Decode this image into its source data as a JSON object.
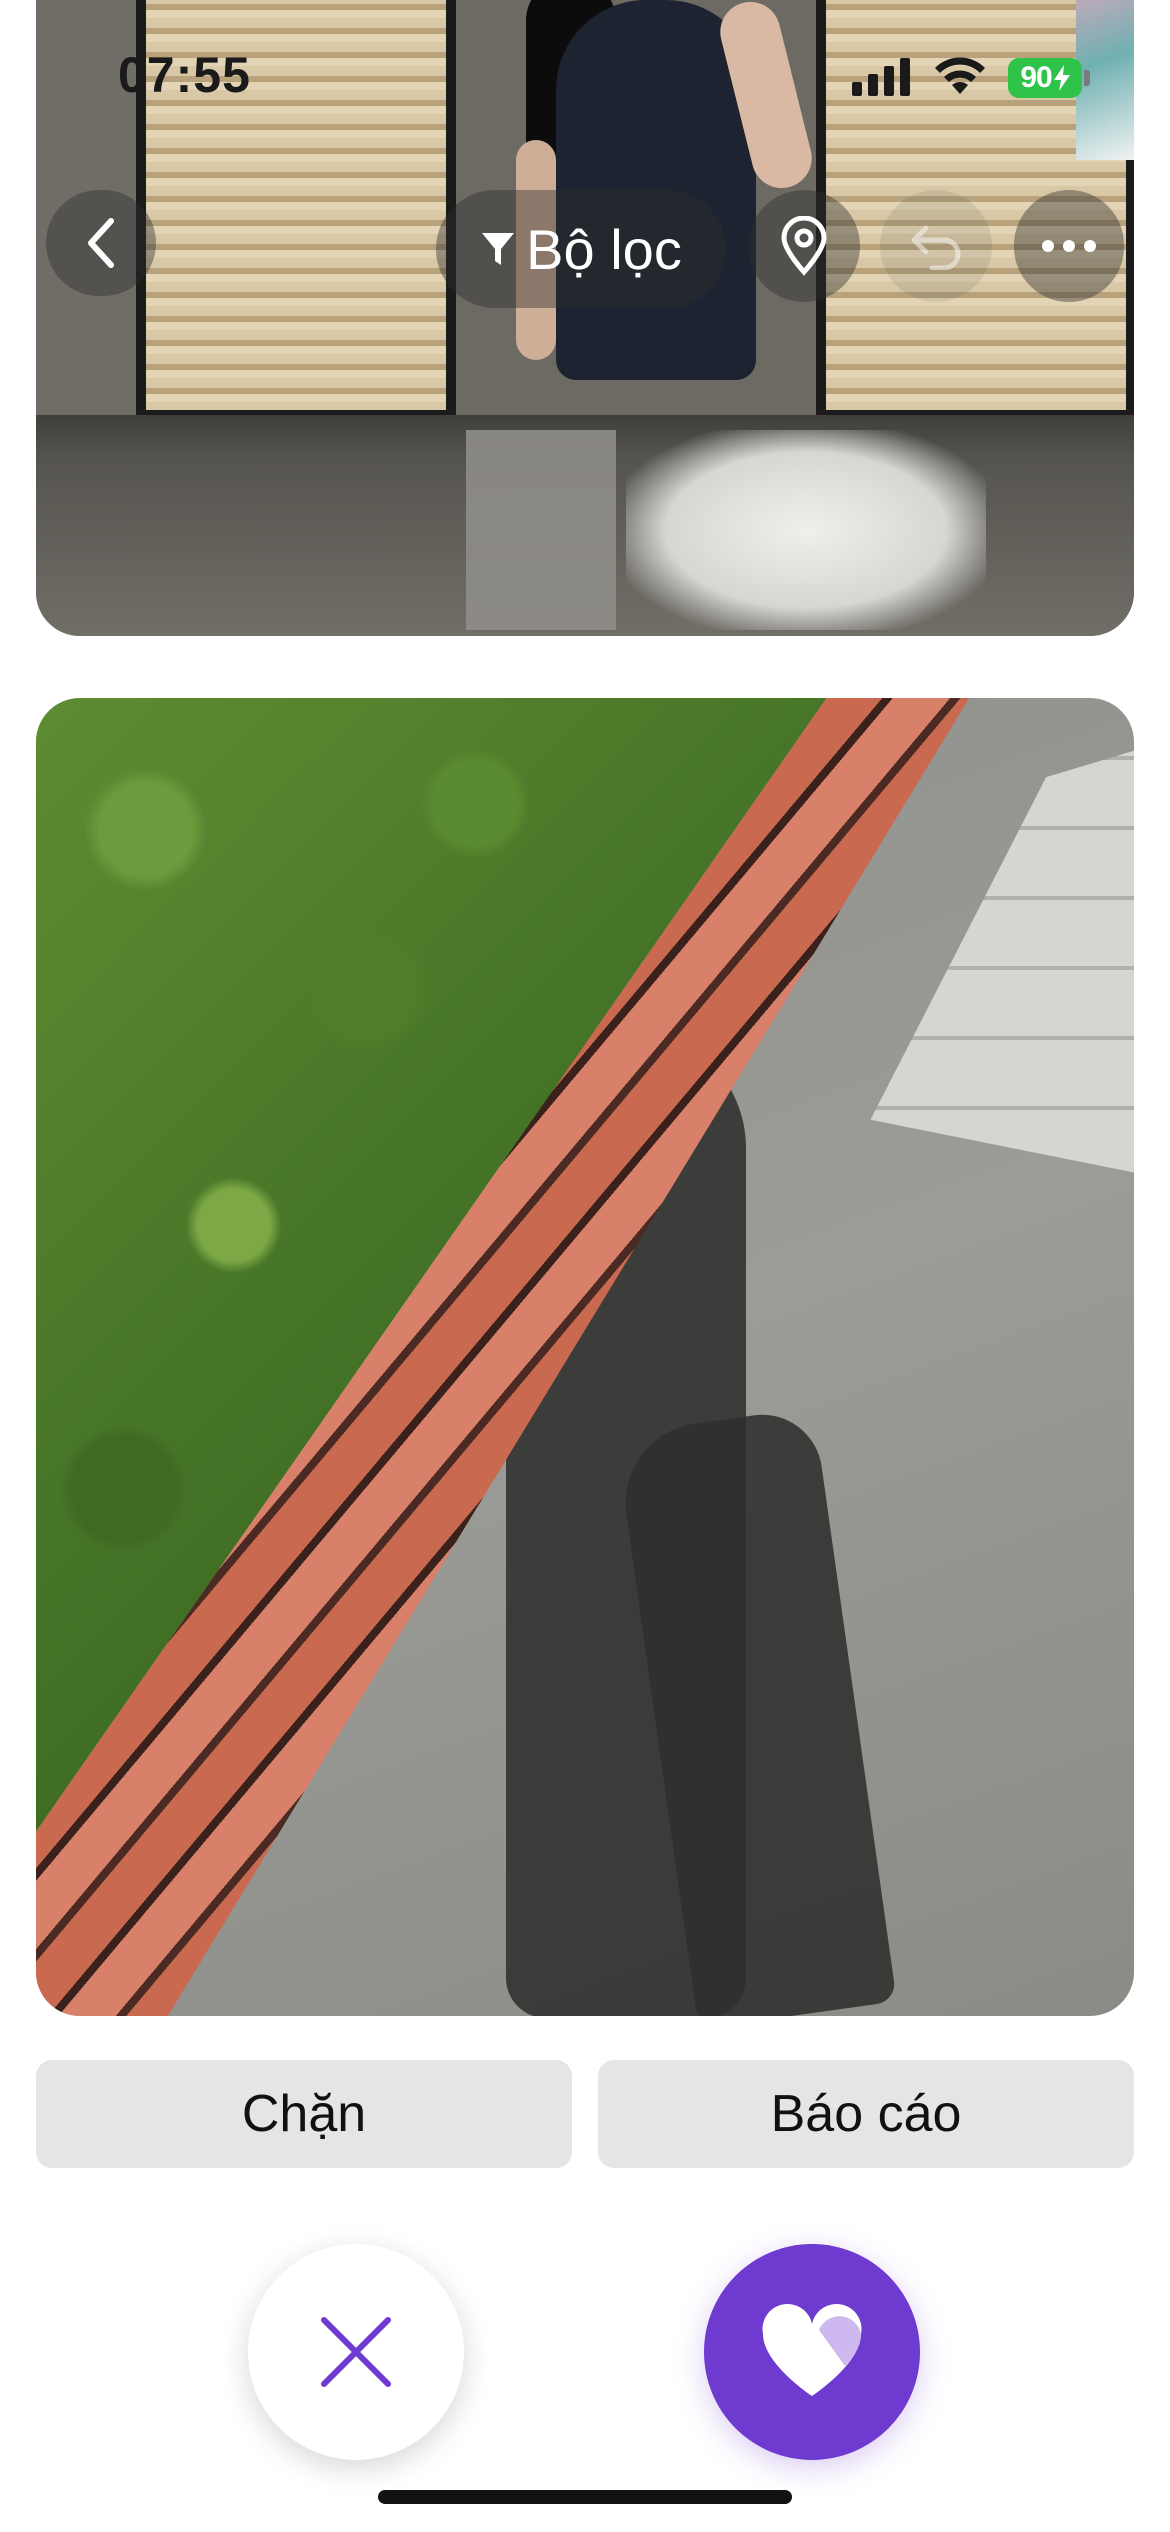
{
  "status_bar": {
    "time": "07:55",
    "battery": "90",
    "battery_color": "#2fc34a"
  },
  "top_bar": {
    "back_icon": "chevron-left-icon",
    "filter_icon": "filter-icon",
    "filter_label": "Bộ lọc",
    "location_icon": "map-pin-icon",
    "undo_icon": "undo-icon",
    "more_icon": "more-horizontal-icon"
  },
  "actions": {
    "block_label": "Chặn",
    "report_label": "Báo cáo"
  },
  "swipe": {
    "nope_icon": "close-icon",
    "like_icon": "heart-icon",
    "accent_color": "#6e3ad0"
  }
}
